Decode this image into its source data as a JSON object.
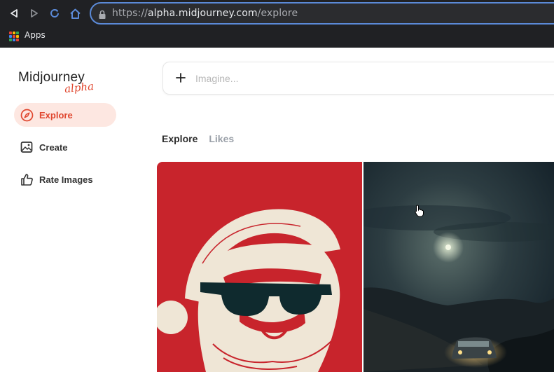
{
  "browser": {
    "url_scheme": "https://",
    "url_host": "alpha.midjourney.com",
    "url_path": "/explore",
    "bookmarks": [
      {
        "label": "Apps"
      }
    ]
  },
  "logo": {
    "name": "Midjourney",
    "badge": "alpha"
  },
  "sidebar": {
    "items": [
      {
        "label": "Explore",
        "icon": "compass-icon",
        "active": true
      },
      {
        "label": "Create",
        "icon": "image-icon",
        "active": false
      },
      {
        "label": "Rate Images",
        "icon": "thumbs-up-icon",
        "active": false
      }
    ]
  },
  "imagine": {
    "placeholder": "Imagine..."
  },
  "tabs": [
    {
      "label": "Explore",
      "active": true
    },
    {
      "label": "Likes",
      "active": false
    }
  ],
  "colors": {
    "accent": "#e0472f",
    "active_bg": "#fde7e1",
    "santa_red": "#c8242c",
    "chrome_bg": "#202124"
  }
}
